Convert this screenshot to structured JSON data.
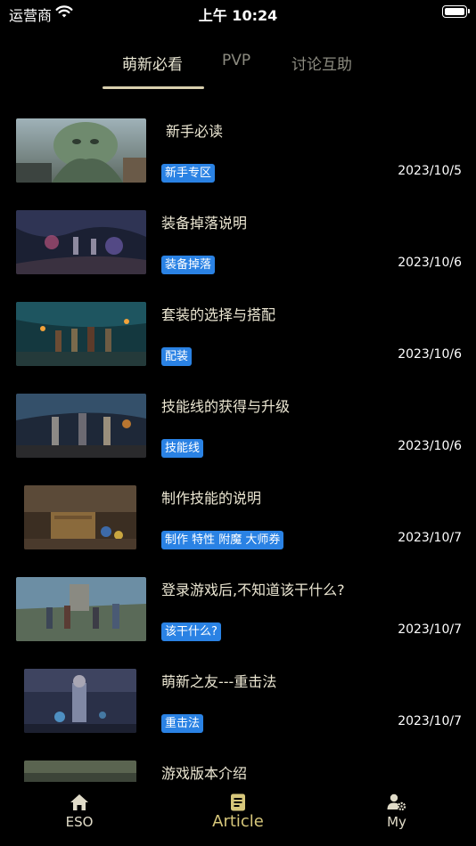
{
  "status_bar": {
    "carrier": "运营商",
    "time": "上午 10:24"
  },
  "top_tabs": [
    {
      "label": "萌新必看",
      "active": true
    },
    {
      "label": "PVP",
      "active": false
    },
    {
      "label": "讨论互助",
      "active": false
    }
  ],
  "articles": [
    {
      "title": "新手必读",
      "tag": "新手专区",
      "date": "2023/10/5"
    },
    {
      "title": "装备掉落说明",
      "tag": "装备掉落",
      "date": "2023/10/6"
    },
    {
      "title": "套装的选择与搭配",
      "tag": "配装",
      "date": "2023/10/6"
    },
    {
      "title": "技能线的获得与升级",
      "tag": "技能线",
      "date": "2023/10/6"
    },
    {
      "title": "制作技能的说明",
      "tag": "制作 特性 附魔 大师券",
      "date": "2023/10/7"
    },
    {
      "title": "登录游戏后,不知道该干什么?",
      "tag": "该干什么?",
      "date": "2023/10/7"
    },
    {
      "title": "萌新之友---重击法",
      "tag": "重击法",
      "date": "2023/10/7"
    },
    {
      "title": "游戏版本介绍",
      "tag": "",
      "date": ""
    }
  ],
  "bottom_nav": [
    {
      "label": "ESO",
      "icon": "home-icon",
      "active": false
    },
    {
      "label": "Article",
      "icon": "article-icon",
      "active": true
    },
    {
      "label": "My",
      "icon": "user-settings-icon",
      "active": false
    }
  ],
  "colors": {
    "tag_bg": "#2a82e4",
    "accent": "#d7c77b",
    "background": "#000000"
  }
}
